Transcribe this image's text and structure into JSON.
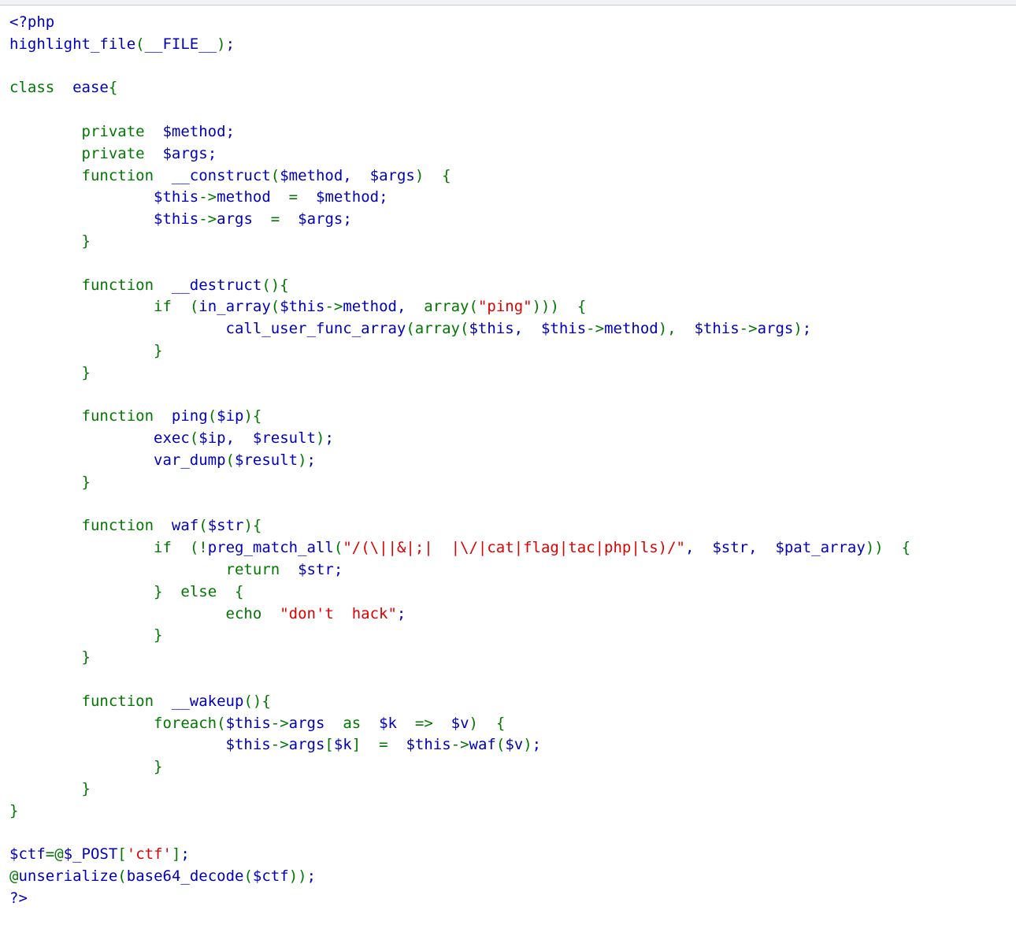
{
  "page": {
    "background_color": "#ffffff",
    "top_strip_color": "#f1f3f4",
    "top_strip_border_color": "#c8cbd0"
  },
  "palette": {
    "keyword": "#007700",
    "default": "#0000BB",
    "string": "#DD0000",
    "comment": "#FF8000",
    "html": "#000000"
  },
  "source": {
    "language": "php",
    "rendered_by": "highlight_file",
    "lines": [
      [
        {
          "t": "<?php",
          "c": "def"
        }
      ],
      [
        {
          "t": "highlight_file",
          "c": "def"
        },
        {
          "t": "(",
          "c": "kw"
        },
        {
          "t": "__FILE__",
          "c": "def"
        },
        {
          "t": ")",
          "c": "kw"
        },
        {
          "t": ";",
          "c": "def"
        }
      ],
      [],
      [
        {
          "t": "class",
          "c": "kw"
        },
        {
          "t": "  ",
          "c": "def"
        },
        {
          "t": "ease",
          "c": "def"
        },
        {
          "t": "{",
          "c": "kw"
        }
      ],
      [],
      [
        {
          "t": "        ",
          "c": "def"
        },
        {
          "t": "private",
          "c": "kw"
        },
        {
          "t": "  ",
          "c": "def"
        },
        {
          "t": "$method",
          "c": "def"
        },
        {
          "t": ";",
          "c": "def"
        }
      ],
      [
        {
          "t": "        ",
          "c": "def"
        },
        {
          "t": "private",
          "c": "kw"
        },
        {
          "t": "  ",
          "c": "def"
        },
        {
          "t": "$args",
          "c": "def"
        },
        {
          "t": ";",
          "c": "def"
        }
      ],
      [
        {
          "t": "        ",
          "c": "def"
        },
        {
          "t": "function",
          "c": "kw"
        },
        {
          "t": "  ",
          "c": "def"
        },
        {
          "t": "__construct",
          "c": "def"
        },
        {
          "t": "(",
          "c": "kw"
        },
        {
          "t": "$method",
          "c": "def"
        },
        {
          "t": ",  ",
          "c": "def"
        },
        {
          "t": "$args",
          "c": "def"
        },
        {
          "t": ")",
          "c": "kw"
        },
        {
          "t": "  ",
          "c": "def"
        },
        {
          "t": "{",
          "c": "kw"
        }
      ],
      [
        {
          "t": "                ",
          "c": "def"
        },
        {
          "t": "$this",
          "c": "def"
        },
        {
          "t": "->",
          "c": "kw"
        },
        {
          "t": "method",
          "c": "def"
        },
        {
          "t": "  ",
          "c": "def"
        },
        {
          "t": "=",
          "c": "kw"
        },
        {
          "t": "  ",
          "c": "def"
        },
        {
          "t": "$method",
          "c": "def"
        },
        {
          "t": ";",
          "c": "def"
        }
      ],
      [
        {
          "t": "                ",
          "c": "def"
        },
        {
          "t": "$this",
          "c": "def"
        },
        {
          "t": "->",
          "c": "kw"
        },
        {
          "t": "args",
          "c": "def"
        },
        {
          "t": "  ",
          "c": "def"
        },
        {
          "t": "=",
          "c": "kw"
        },
        {
          "t": "  ",
          "c": "def"
        },
        {
          "t": "$args",
          "c": "def"
        },
        {
          "t": ";",
          "c": "def"
        }
      ],
      [
        {
          "t": "        ",
          "c": "def"
        },
        {
          "t": "}",
          "c": "kw"
        }
      ],
      [],
      [
        {
          "t": "        ",
          "c": "def"
        },
        {
          "t": "function",
          "c": "kw"
        },
        {
          "t": "  ",
          "c": "def"
        },
        {
          "t": "__destruct",
          "c": "def"
        },
        {
          "t": "()",
          "c": "kw"
        },
        {
          "t": "{",
          "c": "kw"
        }
      ],
      [
        {
          "t": "                ",
          "c": "def"
        },
        {
          "t": "if",
          "c": "kw"
        },
        {
          "t": "  ",
          "c": "def"
        },
        {
          "t": "(",
          "c": "kw"
        },
        {
          "t": "in_array",
          "c": "def"
        },
        {
          "t": "(",
          "c": "kw"
        },
        {
          "t": "$this",
          "c": "def"
        },
        {
          "t": "->",
          "c": "kw"
        },
        {
          "t": "method",
          "c": "def"
        },
        {
          "t": ",  ",
          "c": "def"
        },
        {
          "t": "array",
          "c": "kw"
        },
        {
          "t": "(",
          "c": "kw"
        },
        {
          "t": "\"ping\"",
          "c": "str"
        },
        {
          "t": ")))",
          "c": "kw"
        },
        {
          "t": "  ",
          "c": "def"
        },
        {
          "t": "{",
          "c": "kw"
        }
      ],
      [
        {
          "t": "                        ",
          "c": "def"
        },
        {
          "t": "call_user_func_array",
          "c": "def"
        },
        {
          "t": "(",
          "c": "kw"
        },
        {
          "t": "array",
          "c": "kw"
        },
        {
          "t": "(",
          "c": "kw"
        },
        {
          "t": "$this",
          "c": "def"
        },
        {
          "t": ",  ",
          "c": "def"
        },
        {
          "t": "$this",
          "c": "def"
        },
        {
          "t": "->",
          "c": "kw"
        },
        {
          "t": "method",
          "c": "def"
        },
        {
          "t": "),  ",
          "c": "kw"
        },
        {
          "t": "$this",
          "c": "def"
        },
        {
          "t": "->",
          "c": "kw"
        },
        {
          "t": "args",
          "c": "def"
        },
        {
          "t": ")",
          "c": "kw"
        },
        {
          "t": ";",
          "c": "def"
        }
      ],
      [
        {
          "t": "                ",
          "c": "def"
        },
        {
          "t": "}",
          "c": "kw"
        }
      ],
      [
        {
          "t": "        ",
          "c": "def"
        },
        {
          "t": "}",
          "c": "kw"
        }
      ],
      [],
      [
        {
          "t": "        ",
          "c": "def"
        },
        {
          "t": "function",
          "c": "kw"
        },
        {
          "t": "  ",
          "c": "def"
        },
        {
          "t": "ping",
          "c": "def"
        },
        {
          "t": "(",
          "c": "kw"
        },
        {
          "t": "$ip",
          "c": "def"
        },
        {
          "t": ")",
          "c": "kw"
        },
        {
          "t": "{",
          "c": "kw"
        }
      ],
      [
        {
          "t": "                ",
          "c": "def"
        },
        {
          "t": "exec",
          "c": "def"
        },
        {
          "t": "(",
          "c": "kw"
        },
        {
          "t": "$ip",
          "c": "def"
        },
        {
          "t": ",  ",
          "c": "def"
        },
        {
          "t": "$result",
          "c": "def"
        },
        {
          "t": ")",
          "c": "kw"
        },
        {
          "t": ";",
          "c": "def"
        }
      ],
      [
        {
          "t": "                ",
          "c": "def"
        },
        {
          "t": "var_dump",
          "c": "def"
        },
        {
          "t": "(",
          "c": "kw"
        },
        {
          "t": "$result",
          "c": "def"
        },
        {
          "t": ")",
          "c": "kw"
        },
        {
          "t": ";",
          "c": "def"
        }
      ],
      [
        {
          "t": "        ",
          "c": "def"
        },
        {
          "t": "}",
          "c": "kw"
        }
      ],
      [],
      [
        {
          "t": "        ",
          "c": "def"
        },
        {
          "t": "function",
          "c": "kw"
        },
        {
          "t": "  ",
          "c": "def"
        },
        {
          "t": "waf",
          "c": "def"
        },
        {
          "t": "(",
          "c": "kw"
        },
        {
          "t": "$str",
          "c": "def"
        },
        {
          "t": ")",
          "c": "kw"
        },
        {
          "t": "{",
          "c": "kw"
        }
      ],
      [
        {
          "t": "                ",
          "c": "def"
        },
        {
          "t": "if",
          "c": "kw"
        },
        {
          "t": "  ",
          "c": "def"
        },
        {
          "t": "(!",
          "c": "kw"
        },
        {
          "t": "preg_match_all",
          "c": "def"
        },
        {
          "t": "(",
          "c": "kw"
        },
        {
          "t": "\"/(\\||&|;|  |\\/|cat|flag|tac|php|ls)/\"",
          "c": "str"
        },
        {
          "t": ",  ",
          "c": "def"
        },
        {
          "t": "$str",
          "c": "def"
        },
        {
          "t": ",  ",
          "c": "def"
        },
        {
          "t": "$pat_array",
          "c": "def"
        },
        {
          "t": "))",
          "c": "kw"
        },
        {
          "t": "  ",
          "c": "def"
        },
        {
          "t": "{",
          "c": "kw"
        }
      ],
      [
        {
          "t": "                        ",
          "c": "def"
        },
        {
          "t": "return",
          "c": "kw"
        },
        {
          "t": "  ",
          "c": "def"
        },
        {
          "t": "$str",
          "c": "def"
        },
        {
          "t": ";",
          "c": "def"
        }
      ],
      [
        {
          "t": "                ",
          "c": "def"
        },
        {
          "t": "}",
          "c": "kw"
        },
        {
          "t": "  ",
          "c": "def"
        },
        {
          "t": "else",
          "c": "kw"
        },
        {
          "t": "  ",
          "c": "def"
        },
        {
          "t": "{",
          "c": "kw"
        }
      ],
      [
        {
          "t": "                        ",
          "c": "def"
        },
        {
          "t": "echo",
          "c": "kw"
        },
        {
          "t": "  ",
          "c": "def"
        },
        {
          "t": "\"don't  hack\"",
          "c": "str"
        },
        {
          "t": ";",
          "c": "def"
        }
      ],
      [
        {
          "t": "                ",
          "c": "def"
        },
        {
          "t": "}",
          "c": "kw"
        }
      ],
      [
        {
          "t": "        ",
          "c": "def"
        },
        {
          "t": "}",
          "c": "kw"
        }
      ],
      [],
      [
        {
          "t": "        ",
          "c": "def"
        },
        {
          "t": "function",
          "c": "kw"
        },
        {
          "t": "  ",
          "c": "def"
        },
        {
          "t": "__wakeup",
          "c": "def"
        },
        {
          "t": "()",
          "c": "kw"
        },
        {
          "t": "{",
          "c": "kw"
        }
      ],
      [
        {
          "t": "                ",
          "c": "def"
        },
        {
          "t": "foreach",
          "c": "kw"
        },
        {
          "t": "(",
          "c": "kw"
        },
        {
          "t": "$this",
          "c": "def"
        },
        {
          "t": "->",
          "c": "kw"
        },
        {
          "t": "args",
          "c": "def"
        },
        {
          "t": "  ",
          "c": "def"
        },
        {
          "t": "as",
          "c": "kw"
        },
        {
          "t": "  ",
          "c": "def"
        },
        {
          "t": "$k",
          "c": "def"
        },
        {
          "t": "  ",
          "c": "def"
        },
        {
          "t": "=>",
          "c": "kw"
        },
        {
          "t": "  ",
          "c": "def"
        },
        {
          "t": "$v",
          "c": "def"
        },
        {
          "t": ")",
          "c": "kw"
        },
        {
          "t": "  ",
          "c": "def"
        },
        {
          "t": "{",
          "c": "kw"
        }
      ],
      [
        {
          "t": "                        ",
          "c": "def"
        },
        {
          "t": "$this",
          "c": "def"
        },
        {
          "t": "->",
          "c": "kw"
        },
        {
          "t": "args",
          "c": "def"
        },
        {
          "t": "[",
          "c": "kw"
        },
        {
          "t": "$k",
          "c": "def"
        },
        {
          "t": "]",
          "c": "kw"
        },
        {
          "t": "  ",
          "c": "def"
        },
        {
          "t": "=",
          "c": "kw"
        },
        {
          "t": "  ",
          "c": "def"
        },
        {
          "t": "$this",
          "c": "def"
        },
        {
          "t": "->",
          "c": "kw"
        },
        {
          "t": "waf",
          "c": "def"
        },
        {
          "t": "(",
          "c": "kw"
        },
        {
          "t": "$v",
          "c": "def"
        },
        {
          "t": ")",
          "c": "kw"
        },
        {
          "t": ";",
          "c": "def"
        }
      ],
      [
        {
          "t": "                ",
          "c": "def"
        },
        {
          "t": "}",
          "c": "kw"
        }
      ],
      [
        {
          "t": "        ",
          "c": "def"
        },
        {
          "t": "}",
          "c": "kw"
        }
      ],
      [
        {
          "t": "}",
          "c": "kw"
        }
      ],
      [],
      [
        {
          "t": "$ctf",
          "c": "def"
        },
        {
          "t": "=@",
          "c": "kw"
        },
        {
          "t": "$_POST",
          "c": "def"
        },
        {
          "t": "[",
          "c": "kw"
        },
        {
          "t": "'ctf'",
          "c": "str"
        },
        {
          "t": "]",
          "c": "kw"
        },
        {
          "t": ";",
          "c": "def"
        }
      ],
      [
        {
          "t": "@",
          "c": "kw"
        },
        {
          "t": "unserialize",
          "c": "def"
        },
        {
          "t": "(",
          "c": "kw"
        },
        {
          "t": "base64_decode",
          "c": "def"
        },
        {
          "t": "(",
          "c": "kw"
        },
        {
          "t": "$ctf",
          "c": "def"
        },
        {
          "t": "))",
          "c": "kw"
        },
        {
          "t": ";",
          "c": "def"
        }
      ],
      [
        {
          "t": "?>",
          "c": "def"
        }
      ]
    ],
    "plain_text": "<?php\nhighlight_file(__FILE__);\n\nclass  ease{\n\n        private  $method;\n        private  $args;\n        function  __construct($method,  $args)  {\n                $this->method  =  $method;\n                $this->args  =  $args;\n        }\n\n        function  __destruct(){\n                if  (in_array($this->method,  array(\"ping\")))  {\n                        call_user_func_array(array($this,  $this->method),  $this->args);\n                }\n        }\n\n        function  ping($ip){\n                exec($ip,  $result);\n                var_dump($result);\n        }\n\n        function  waf($str){\n                if  (!preg_match_all(\"/(\\||&|;|  |\\/|cat|flag|tac|php|ls)/\",  $str,  $pat_array))  {\n                        return  $str;\n                }  else  {\n                        echo  \"don't  hack\";\n                }\n        }\n\n        function  __wakeup(){\n                foreach($this->args  as  $k  =>  $v)  {\n                        $this->args[$k]  =  $this->waf($v);\n                }\n        }\n}\n\n$ctf=@$_POST['ctf'];\n@unserialize(base64_decode($ctf));\n?>"
  }
}
